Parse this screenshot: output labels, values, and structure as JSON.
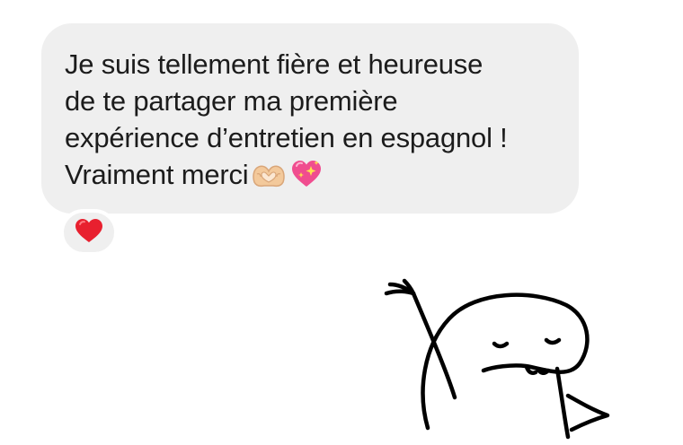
{
  "message": {
    "lines": [
      "Je suis tellement fière et heureuse",
      "de te partager ma première",
      "expérience d’entretien en espagnol !",
      "Vraiment merci"
    ],
    "emojis": [
      "heart-hands-emoji",
      "sparkling-heart-emoji"
    ]
  },
  "reaction": {
    "emoji": "red-heart-emoji",
    "color": "#e8202f"
  },
  "sticker": {
    "name": "waving-blob-doodle"
  },
  "colors": {
    "bubble": "#efefef",
    "text": "#1c1c1c",
    "background": "#ffffff"
  }
}
